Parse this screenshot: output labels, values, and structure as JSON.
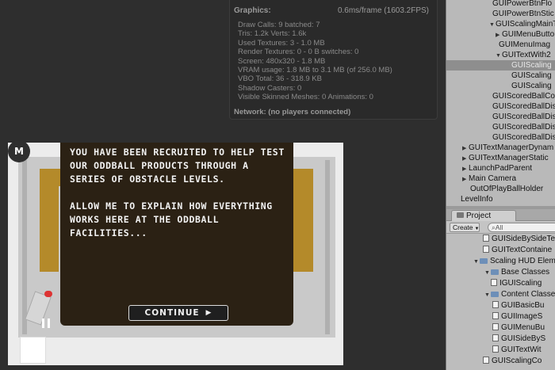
{
  "stats": {
    "heading": "Graphics:",
    "frametime": "0.6ms/frame (1603.2FPS)",
    "lines": [
      "Draw Calls: 9  batched: 7",
      "Tris: 1.2k  Verts: 1.6k",
      "Used Textures: 3 - 1.0 MB",
      "Render Textures: 0 - 0 B  switches: 0",
      "Screen: 480x320 - 1.8 MB",
      "VRAM usage: 1.8 MB to 3.1 MB (of 256.0 MB)",
      "VBO Total: 36 - 318.9 KB",
      "Shadow Casters: 0",
      "Visible Skinned Meshes: 0          Animations: 0"
    ],
    "network": "Network: (no players connected)"
  },
  "game": {
    "menu_badge": "M",
    "dialog_paragraph_1": "YOU HAVE BEEN RECRUITED TO HELP TEST OUR ODDBALL PRODUCTS THROUGH A SERIES OF OBSTACLE LEVELS.",
    "dialog_paragraph_2": "ALLOW ME TO EXPLAIN HOW EVERYTHING WORKS HERE AT THE ODDBALL FACILITIES...",
    "continue_label": "CONTINUE",
    "continue_icon": "play-arrow",
    "colors": {
      "wall": "#b48a2a",
      "dialog_bg": "#2b2114",
      "ball": "#dd3333"
    }
  },
  "hierarchy": {
    "items": [
      {
        "label": "GUIPowerBtnFlo",
        "arrow": ""
      },
      {
        "label": "GUIPowerBtnStic",
        "arrow": ""
      },
      {
        "label": "GUIScalingMainT",
        "arrow": "▼"
      },
      {
        "label": "GUIMenuButto",
        "arrow": "▶"
      },
      {
        "label": "GUIMenuImag",
        "arrow": ""
      },
      {
        "label": "GUITextWith2",
        "arrow": "▼"
      },
      {
        "label": "GUIScaling",
        "arrow": ""
      },
      {
        "label": "GUIScaling",
        "arrow": ""
      },
      {
        "label": "GUIScaling",
        "arrow": ""
      },
      {
        "label": "GUIScoredBallCo",
        "arrow": ""
      },
      {
        "label": "GUIScoredBallDis",
        "arrow": ""
      },
      {
        "label": "GUIScoredBallDis",
        "arrow": ""
      },
      {
        "label": "GUIScoredBallDis",
        "arrow": ""
      },
      {
        "label": "GUIScoredBallDis",
        "arrow": ""
      },
      {
        "label": "GUITextManagerDynam",
        "arrow": "▶"
      },
      {
        "label": "GUITextManagerStatic",
        "arrow": "▶"
      },
      {
        "label": "LaunchPadParent",
        "arrow": "▶"
      },
      {
        "label": "Main Camera",
        "arrow": "▶"
      },
      {
        "label": "OutOfPlayBallHolder",
        "arrow": ""
      },
      {
        "label": "LevelInfo",
        "arrow": ""
      }
    ]
  },
  "project": {
    "tab_label": "Project",
    "create_label": "Create",
    "search_placeholder": "All",
    "items": [
      {
        "label": "GUISideBySideTe",
        "type": "script"
      },
      {
        "label": "GUITextContaine",
        "type": "script"
      },
      {
        "label": "Scaling HUD Elem",
        "type": "folder",
        "arrow": "▼"
      },
      {
        "label": "Base Classes",
        "type": "folder",
        "arrow": "▼"
      },
      {
        "label": "IGUIScaling",
        "type": "script"
      },
      {
        "label": "Content Classe",
        "type": "folder",
        "arrow": "▼"
      },
      {
        "label": "GUIBasicBu",
        "type": "script"
      },
      {
        "label": "GUIImageS",
        "type": "script"
      },
      {
        "label": "GUIMenuBu",
        "type": "script"
      },
      {
        "label": "GUISideByS",
        "type": "script"
      },
      {
        "label": "GUITextWit",
        "type": "script"
      },
      {
        "label": "GUIScalingCo",
        "type": "script"
      }
    ]
  }
}
